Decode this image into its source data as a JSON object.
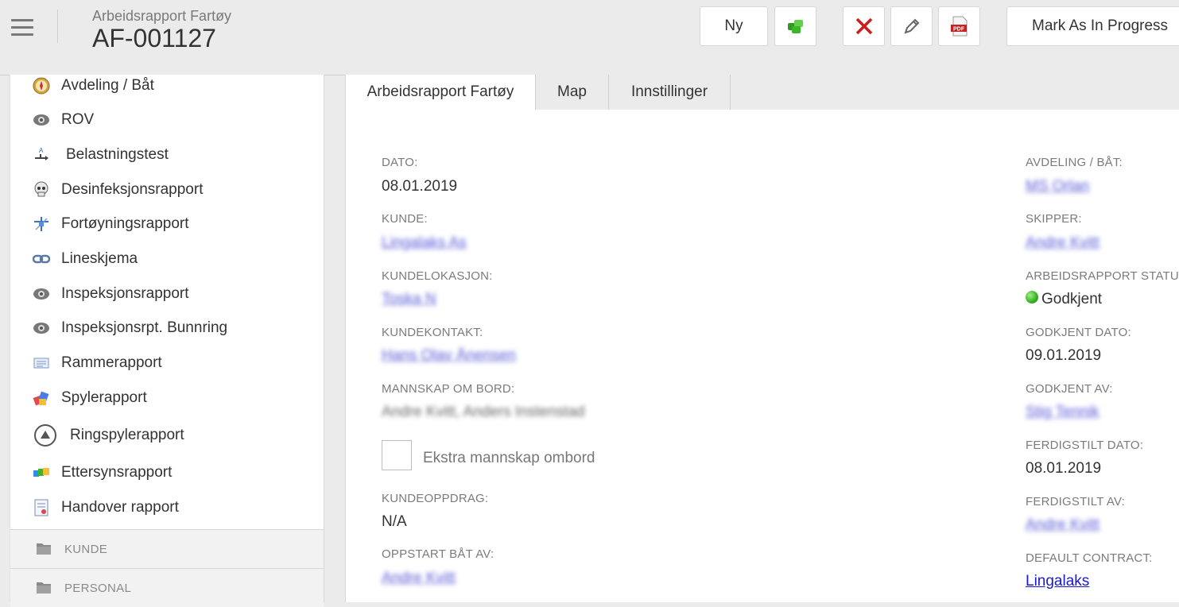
{
  "header": {
    "subtitle": "Arbeidsrapport Fartøy",
    "title": "AF-001127",
    "buttons": {
      "new_label": "Ny",
      "progress_label": "Mark As In Progress"
    },
    "icons": [
      "hamburger-menu-icon",
      "copy-green-icon",
      "delete-x-icon",
      "pencil-edit-icon",
      "pdf-icon"
    ]
  },
  "sidebar": {
    "items": [
      {
        "label": "Avdeling / Båt",
        "icon": "compass-icon"
      },
      {
        "label": "ROV",
        "icon": "eye-icon"
      },
      {
        "label": "Belastningstest",
        "icon": "load-test-icon"
      },
      {
        "label": "Desinfeksjonsrapport",
        "icon": "skull-icon"
      },
      {
        "label": "Fortøyningsrapport",
        "icon": "mooring-icon"
      },
      {
        "label": "Lineskjema",
        "icon": "chain-link-icon"
      },
      {
        "label": "Inspeksjonsrapport",
        "icon": "eye-icon"
      },
      {
        "label": "Inspeksjonsrpt. Bunnring",
        "icon": "eye-icon"
      },
      {
        "label": "Rammerapport",
        "icon": "frame-icon"
      },
      {
        "label": "Spylerapport",
        "icon": "washer-icon"
      },
      {
        "label": "Ringspylerapport",
        "icon": "triangle-circle-icon"
      },
      {
        "label": "Ettersynsrapport",
        "icon": "color-blocks-icon"
      },
      {
        "label": "Handover rapport",
        "icon": "document-icon"
      }
    ],
    "sections": [
      {
        "label": "KUNDE",
        "icon": "folder-icon"
      },
      {
        "label": "PERSONAL",
        "icon": "folder-icon"
      }
    ]
  },
  "tabs": [
    {
      "label": "Arbeidsrapport Fartøy",
      "active": true
    },
    {
      "label": "Map",
      "active": false
    },
    {
      "label": "Innstillinger",
      "active": false
    }
  ],
  "form": {
    "left": {
      "dato": {
        "label": "DATO:",
        "value": "08.01.2019"
      },
      "kunde": {
        "label": "KUNDE:",
        "value": "Lingalaks As"
      },
      "kundelokasjon": {
        "label": "KUNDELOKASJON:",
        "value": "Toska N"
      },
      "kundekontakt": {
        "label": "KUNDEKONTAKT:",
        "value": "Hans Olav Ånensen"
      },
      "mannskap": {
        "label": "MANNSKAP OM BORD:",
        "value": "Andre Kvitt, Anders Instenstad"
      },
      "ekstra": {
        "label": "Ekstra mannskap ombord"
      },
      "kundeoppdrag": {
        "label": "KUNDEOPPDRAG:",
        "value": "N/A"
      },
      "oppstart": {
        "label": "OPPSTART BÅT AV:",
        "value": "Andre Kvitt"
      }
    },
    "right": {
      "avdeling": {
        "label": "AVDELING / BÅT:",
        "value": "MS Orlan"
      },
      "skipper": {
        "label": "SKIPPER:",
        "value": "Andre Kvitt"
      },
      "status": {
        "label": "ARBEIDSRAPPORT STATUS:",
        "value": "Godkjent",
        "color": "#3cb528"
      },
      "godkjent_dato": {
        "label": "GODKJENT DATO:",
        "value": "09.01.2019"
      },
      "godkjent_av": {
        "label": "GODKJENT AV:",
        "value": "Stig Tennik"
      },
      "ferdigstilt_dato": {
        "label": "FERDIGSTILT DATO:",
        "value": "08.01.2019"
      },
      "ferdigstilt_av": {
        "label": "FERDIGSTILT AV:",
        "value": "Andre Kvitt"
      },
      "default_contract": {
        "label": "DEFAULT CONTRACT:",
        "value": "Lingalaks"
      }
    }
  },
  "colors": {
    "link": "#1a1acc",
    "delete_red": "#d11a1a",
    "accent_green": "#3cb528"
  }
}
